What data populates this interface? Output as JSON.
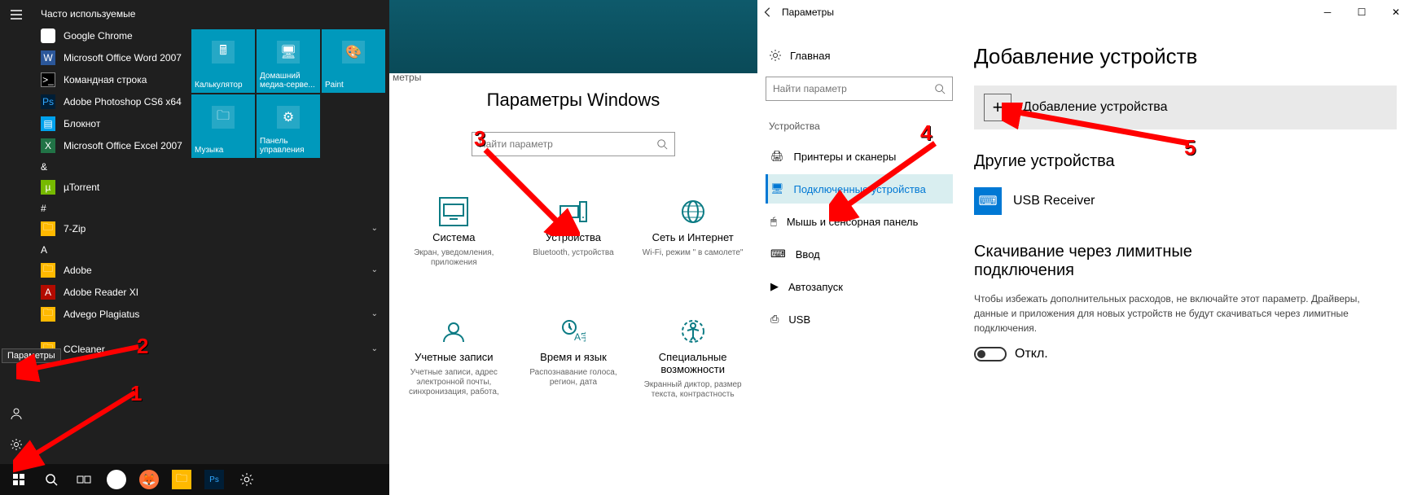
{
  "annotations": {
    "n1": "1",
    "n2": "2",
    "n3": "3",
    "n4": "4",
    "n5": "5"
  },
  "start": {
    "tooltip": "Параметры",
    "sections": {
      "frequent": "Часто используемые",
      "ampersand": "&",
      "digits": "#",
      "A": "A"
    },
    "apps": {
      "chrome": "Google Chrome",
      "word": "Microsoft Office Word 2007",
      "cmd": "Командная строка",
      "ps": "Adobe Photoshop CS6 x64",
      "notepad": "Блокнот",
      "excel": "Microsoft Office Excel 2007",
      "utorrent": "µTorrent",
      "sevenzip": "7-Zip",
      "adobe": "Adobe",
      "reader": "Adobe Reader XI",
      "advego": "Advego Plagiatus",
      "ccleaner": "CCleaner"
    },
    "tiles": {
      "calc": "Калькулятор",
      "media": "Домашний медиа-серве...",
      "paint": "Paint",
      "music": "Музыка",
      "panel": "Панель управления"
    }
  },
  "mid": {
    "breadcrumb": "метры",
    "title": "Параметры Windows",
    "search_ph": "Найти параметр",
    "cats": {
      "system": {
        "t": "Система",
        "s": "Экран, уведомления, приложения"
      },
      "devices": {
        "t": "Устройства",
        "s": "Bluetooth, устройства"
      },
      "network": {
        "t": "Сеть и Интернет",
        "s": "Wi-Fi, режим \" в самолете\""
      },
      "accounts": {
        "t": "Учетные записи",
        "s": "Учетные записи, адрес электронной почты, синхронизация, работа,"
      },
      "timelang": {
        "t": "Время и язык",
        "s": "Распознавание голоса, регион, дата"
      },
      "ease": {
        "t": "Специальные возможности",
        "s": "Экранный диктор, размер текста, контрастность"
      }
    }
  },
  "right": {
    "title": "Параметры",
    "home": "Главная",
    "search_ph": "Найти параметр",
    "section": "Устройства",
    "items": {
      "printers": "Принтеры и сканеры",
      "connected": "Подключенные устройства",
      "mouse": "Мышь и сенсорная панель",
      "input": "Ввод",
      "autoplay": "Автозапуск",
      "usb": "USB"
    },
    "h1": "Добавление устройств",
    "add": "Добавление устройства",
    "h2": "Другие устройства",
    "usb_receiver": "USB Receiver",
    "h3": "Скачивание через лимитные подключения",
    "metered": "Чтобы избежать дополнительных расходов, не включайте этот параметр. Драйверы, данные и приложения для новых устройств не будут скачиваться через лимитные подключения.",
    "toggle": "Откл."
  }
}
